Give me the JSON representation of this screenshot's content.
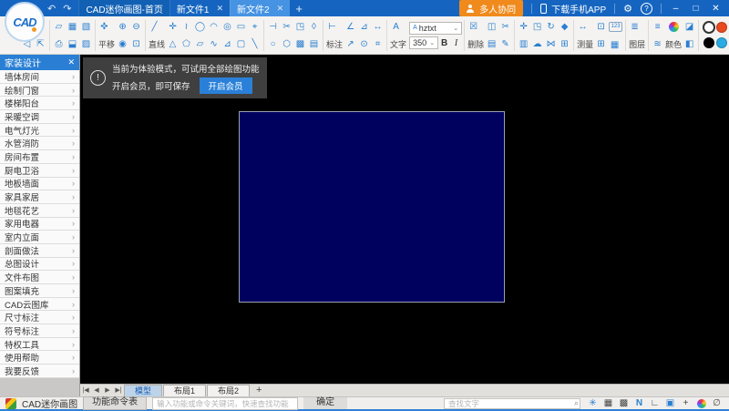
{
  "titlebar": {
    "back_icon": "↶",
    "forward_icon": "↷",
    "tabs": [
      {
        "label": "CAD迷你画图-首页",
        "closable": false,
        "active": false
      },
      {
        "label": "新文件1",
        "closable": true,
        "active": false
      },
      {
        "label": "新文件2",
        "closable": true,
        "active": true
      }
    ],
    "new_tab_label": "+",
    "collab_label": "多人协同",
    "download_label": "下载手机APP",
    "gear_icon": "⚙",
    "help_label": "?",
    "window_controls": {
      "minimize": "–",
      "maximize": "□",
      "close": "✕"
    }
  },
  "toolbar": {
    "groups": [
      {
        "name": "file-left",
        "rows": [
          [
            "",
            ""
          ],
          [
            "back2",
            "export2"
          ]
        ]
      },
      {
        "name": "file",
        "rows": [
          [
            "open",
            "save",
            "saveas"
          ],
          [
            "print",
            "pdf",
            "image"
          ]
        ]
      },
      {
        "name": "view",
        "rows": [
          [
            "pan",
            "zoomin",
            "zoomout"
          ],
          [
            "t:平移",
            "zoomext",
            "zoomwin"
          ]
        ]
      },
      {
        "name": "draw",
        "rows": [
          [
            "line",
            "point",
            "pline",
            "ellipse",
            "arc",
            "circle",
            "rect",
            "target"
          ],
          [
            "t:直线",
            "tri",
            "pent",
            "para",
            "spline",
            "trap",
            "rrect",
            "diag"
          ]
        ]
      },
      {
        "name": "modify",
        "rows": [
          [
            "offset",
            "trim",
            "region",
            "droplet"
          ],
          [
            "poly1",
            "poly2",
            "hatch",
            "folder2"
          ]
        ]
      },
      {
        "name": "dimension",
        "rows": [
          [
            "dimicon",
            "dimangle",
            "dimslope",
            "dimh"
          ],
          [
            "t:标注",
            "dimlead",
            "dimradius",
            "dimarea"
          ]
        ]
      },
      {
        "name": "text",
        "type": "text"
      },
      {
        "name": "delete",
        "rows": [
          [
            "trash",
            "copy",
            "cut"
          ],
          [
            "t:删除",
            "paste",
            "brush"
          ]
        ]
      },
      {
        "name": "transform",
        "rows": [
          [
            "move",
            "scale",
            "rotate",
            "blocks"
          ],
          [
            "clip",
            "cloud",
            "mirror",
            "array"
          ]
        ]
      },
      {
        "name": "measure",
        "rows": [
          [
            "measlen",
            "shot",
            "count"
          ],
          [
            "t:测量",
            "calcgrid",
            "table"
          ]
        ]
      },
      {
        "name": "layer",
        "rows": [
          [
            "layers"
          ],
          [
            "t:图层"
          ]
        ]
      },
      {
        "name": "color",
        "rows": [
          [
            "linetype",
            "wheel",
            "eraser"
          ],
          [
            "linetype2",
            "t:颜色",
            "bucket"
          ]
        ]
      },
      {
        "name": "swatches",
        "type": "swatches"
      }
    ],
    "text_group": {
      "icon": "A",
      "label": "文字",
      "font_name": "hztxt",
      "font_size": "350",
      "bold": "B",
      "italic": "I",
      "caret": "⌄",
      "mini_a": "A"
    },
    "swatches": [
      "#ffffff",
      "#e8491f",
      "#f2e213",
      "#8fcf52",
      "#000000",
      "#2aabe3",
      "#159a52",
      "#7c3fa0"
    ],
    "icons": {
      "back2": "◁",
      "export2": "⇱",
      "open": "▱",
      "save": "▦",
      "saveas": "▧",
      "print": "⎙",
      "pdf": "⬓",
      "image": "▨",
      "pan": "✜",
      "zoomin": "⊕",
      "zoomout": "⊖",
      "zoomext": "◉",
      "zoomwin": "⊡",
      "line": "╱",
      "point": "✛",
      "pline": "≀",
      "ellipse": "◯",
      "arc": "◠",
      "circle": "◎",
      "rect": "▭",
      "target": "⌖",
      "tri": "△",
      "pent": "⬠",
      "para": "▱",
      "spline": "∿",
      "trap": "⊿",
      "rrect": "▢",
      "diag": "╲",
      "offset": "⊣",
      "trim": "✂",
      "region": "◳",
      "droplet": "◊",
      "poly1": "○",
      "poly2": "⬡",
      "hatch": "▩",
      "folder2": "▤",
      "dimicon": "⊢",
      "dimangle": "∠",
      "dimslope": "⊿",
      "dimh": "↔",
      "dimlead": "↗",
      "dimradius": "⊙",
      "dimarea": "⌗",
      "trash": "☒",
      "copy": "◫",
      "cut": "✂",
      "paste": "▤",
      "brush": "✎",
      "move": "✛",
      "scale": "◳",
      "rotate": "↻",
      "blocks": "◆",
      "clip": "▥",
      "cloud": "☁",
      "mirror": "⋈",
      "array": "⊞",
      "measlen": "↔",
      "shot": "⊡",
      "count": "123",
      "calcgrid": "⊞",
      "table": "▦",
      "layers": "≣",
      "linetype": "≡",
      "linetype2": "≋",
      "eraser": "◪",
      "bucket": "◧"
    }
  },
  "sidebar": {
    "title": "家装设计",
    "close_icon": "✕",
    "chevron": "›",
    "items": [
      "墙体房间",
      "绘制门窗",
      "楼梯阳台",
      "采暖空调",
      "电气灯光",
      "水管消防",
      "房间布置",
      "厨电卫浴",
      "地板墙面",
      "家具家居",
      "地毯花艺",
      "家用电器",
      "室内立面",
      "剖面做法",
      "总图设计",
      "文件布图",
      "图案填充",
      "CAD云图库",
      "尺寸标注",
      "符号标注",
      "特权工具",
      "使用帮助",
      "我要反馈"
    ]
  },
  "banner": {
    "icon": "!",
    "line1": "当前为体验模式，可试用全部绘图功能",
    "line2": "开启会员，即可保存",
    "button": "开启会员"
  },
  "canvas": {
    "rect_fill": "#00005f"
  },
  "layout_tabs": {
    "nav_icons": [
      "|◀",
      "◀",
      "▶",
      "▶|"
    ],
    "tabs": [
      {
        "label": "模型",
        "active": true
      },
      {
        "label": "布局1",
        "active": false
      },
      {
        "label": "布局2",
        "active": false
      }
    ],
    "add_label": "+"
  },
  "command_bar": {
    "app_name": "CAD迷你画图",
    "menu_button": "功能命令表",
    "input_placeholder": "输入功能或命令关键词，快速查找功能",
    "confirm_button": "确定",
    "find_placeholder": "查找文字",
    "search_icon": "⌕",
    "right_icons": [
      {
        "name": "snap-axis-icon",
        "glyph": "✳",
        "accent": true
      },
      {
        "name": "grid-icon",
        "glyph": "▦",
        "accent": false
      },
      {
        "name": "grid-dots-icon",
        "glyph": "▩",
        "accent": false
      },
      {
        "name": "nav-n-icon",
        "glyph": "N",
        "accent": true
      },
      {
        "name": "ortho-icon",
        "glyph": "∟",
        "accent": false
      },
      {
        "name": "screen-icon",
        "glyph": "▣",
        "accent": true
      },
      {
        "name": "crosshair-icon",
        "glyph": "+",
        "accent": false
      },
      {
        "name": "colorball-icon",
        "glyph": "",
        "accent": false,
        "ball": true
      },
      {
        "name": "lasso-icon",
        "glyph": "∅",
        "accent": false
      }
    ]
  }
}
